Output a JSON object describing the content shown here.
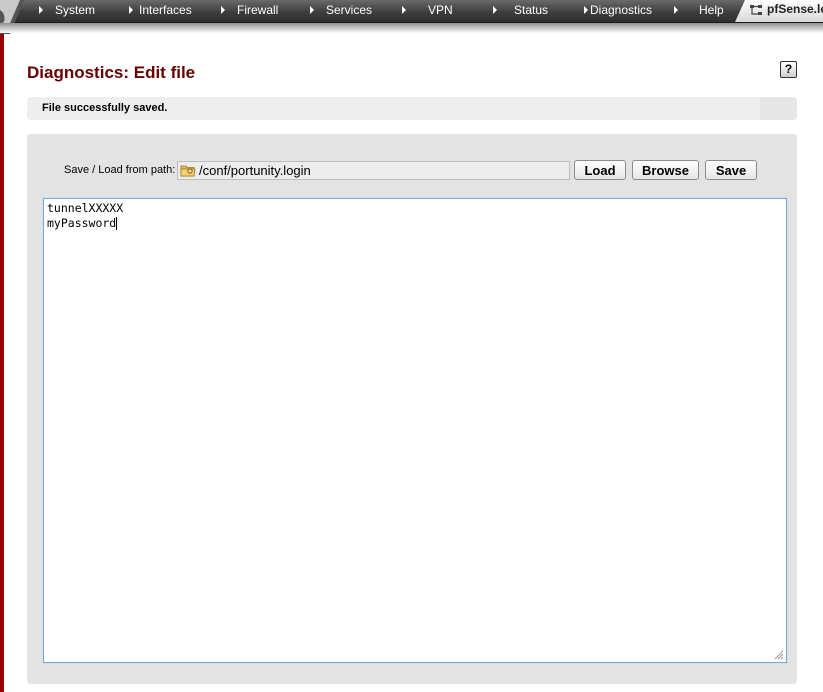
{
  "nav": {
    "items": [
      {
        "label": "System"
      },
      {
        "label": "Interfaces"
      },
      {
        "label": "Firewall"
      },
      {
        "label": "Services"
      },
      {
        "label": "VPN"
      },
      {
        "label": "Status"
      },
      {
        "label": "Diagnostics"
      },
      {
        "label": "Help"
      }
    ],
    "brand_label": "pfSense.lo"
  },
  "page": {
    "title": "Diagnostics: Edit file",
    "help_label": "?"
  },
  "status": {
    "message": "File successfully saved."
  },
  "path_form": {
    "label": "Save / Load from path:",
    "path_value": "/conf/portunity.login",
    "load_label": "Load",
    "browse_label": "Browse",
    "save_label": "Save"
  },
  "editor": {
    "lines": [
      "tunnelXXXXX",
      "myPassword"
    ]
  },
  "colors": {
    "title": "#660000",
    "frame": "#990000",
    "nav_bg": "#3e3e3e",
    "panel_bg": "#e3e3e3"
  },
  "icons": {
    "nav_arrow": "triangle-right-icon",
    "brand": "network-icon",
    "help": "help-icon",
    "folder": "folder-icon"
  }
}
